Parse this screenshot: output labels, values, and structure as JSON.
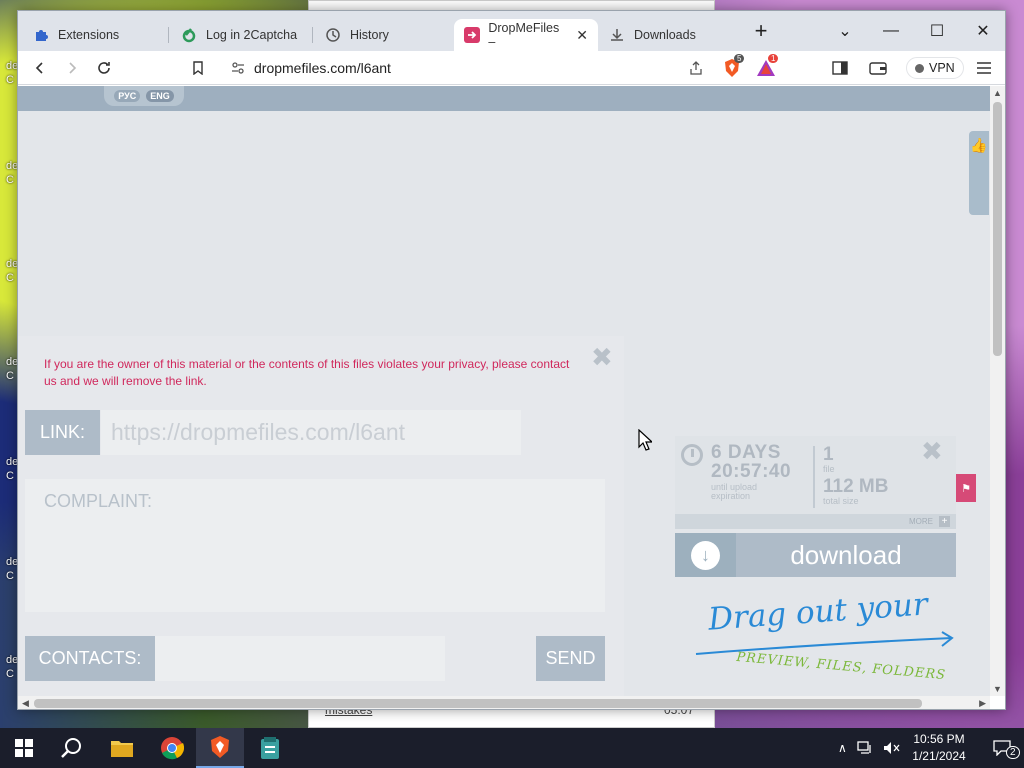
{
  "desktop": {
    "icon_labels": [
      "de",
      "C",
      "de",
      "C",
      "de",
      "C",
      "de",
      "C",
      "de",
      "C",
      "de",
      "C",
      "de",
      "C"
    ]
  },
  "background_window": {
    "row_text": "mistakes",
    "row_time": "05:07"
  },
  "tabs": [
    {
      "label": "Extensions",
      "icon": "puzzle-icon",
      "active": false
    },
    {
      "label": "Log in 2Captcha",
      "icon": "2captcha-icon",
      "active": false
    },
    {
      "label": "History",
      "icon": "history-icon",
      "active": false
    },
    {
      "label": "DropMeFiles –",
      "icon": "dropmefiles-icon",
      "active": true
    },
    {
      "label": "Downloads",
      "icon": "download-icon",
      "active": false
    }
  ],
  "toolbar": {
    "url": "dropmefiles.com/l6ant",
    "brave_badge": "5",
    "rewards_badge": "1",
    "vpn_label": "VPN"
  },
  "page": {
    "lang_ru": "РУС",
    "lang_en": "ENG",
    "complaint_message": "If you are the owner of this material or the contents of this files violates your privacy, please contact us and we will remove the link.",
    "link_label": "LINK:",
    "link_value": "https://dropmefiles.com/l6ant",
    "complaint_label": "COMPLAINT:",
    "contacts_label": "CONTACTS:",
    "send_label": "SEND",
    "days": "6 DAYS",
    "timer": "20:57:40",
    "timer_sub_1": "until upload",
    "timer_sub_2": "expiration",
    "file_count": "1",
    "file_label": "file",
    "size_value": "112 MB",
    "size_label": "total size",
    "more_label": "MORE",
    "download_label": "download",
    "drag_title": "Drag out your",
    "drag_subtitle": "PREVIEW, FILES, FOLDERS"
  },
  "taskbar": {
    "time": "10:56 PM",
    "date": "1/21/2024",
    "notifications": "2"
  },
  "colors": {
    "accent_pink": "#d0285c",
    "panel_blue": "#aebbc8",
    "drag_blue": "#2a8ad6",
    "drag_green": "#7bb83a"
  }
}
